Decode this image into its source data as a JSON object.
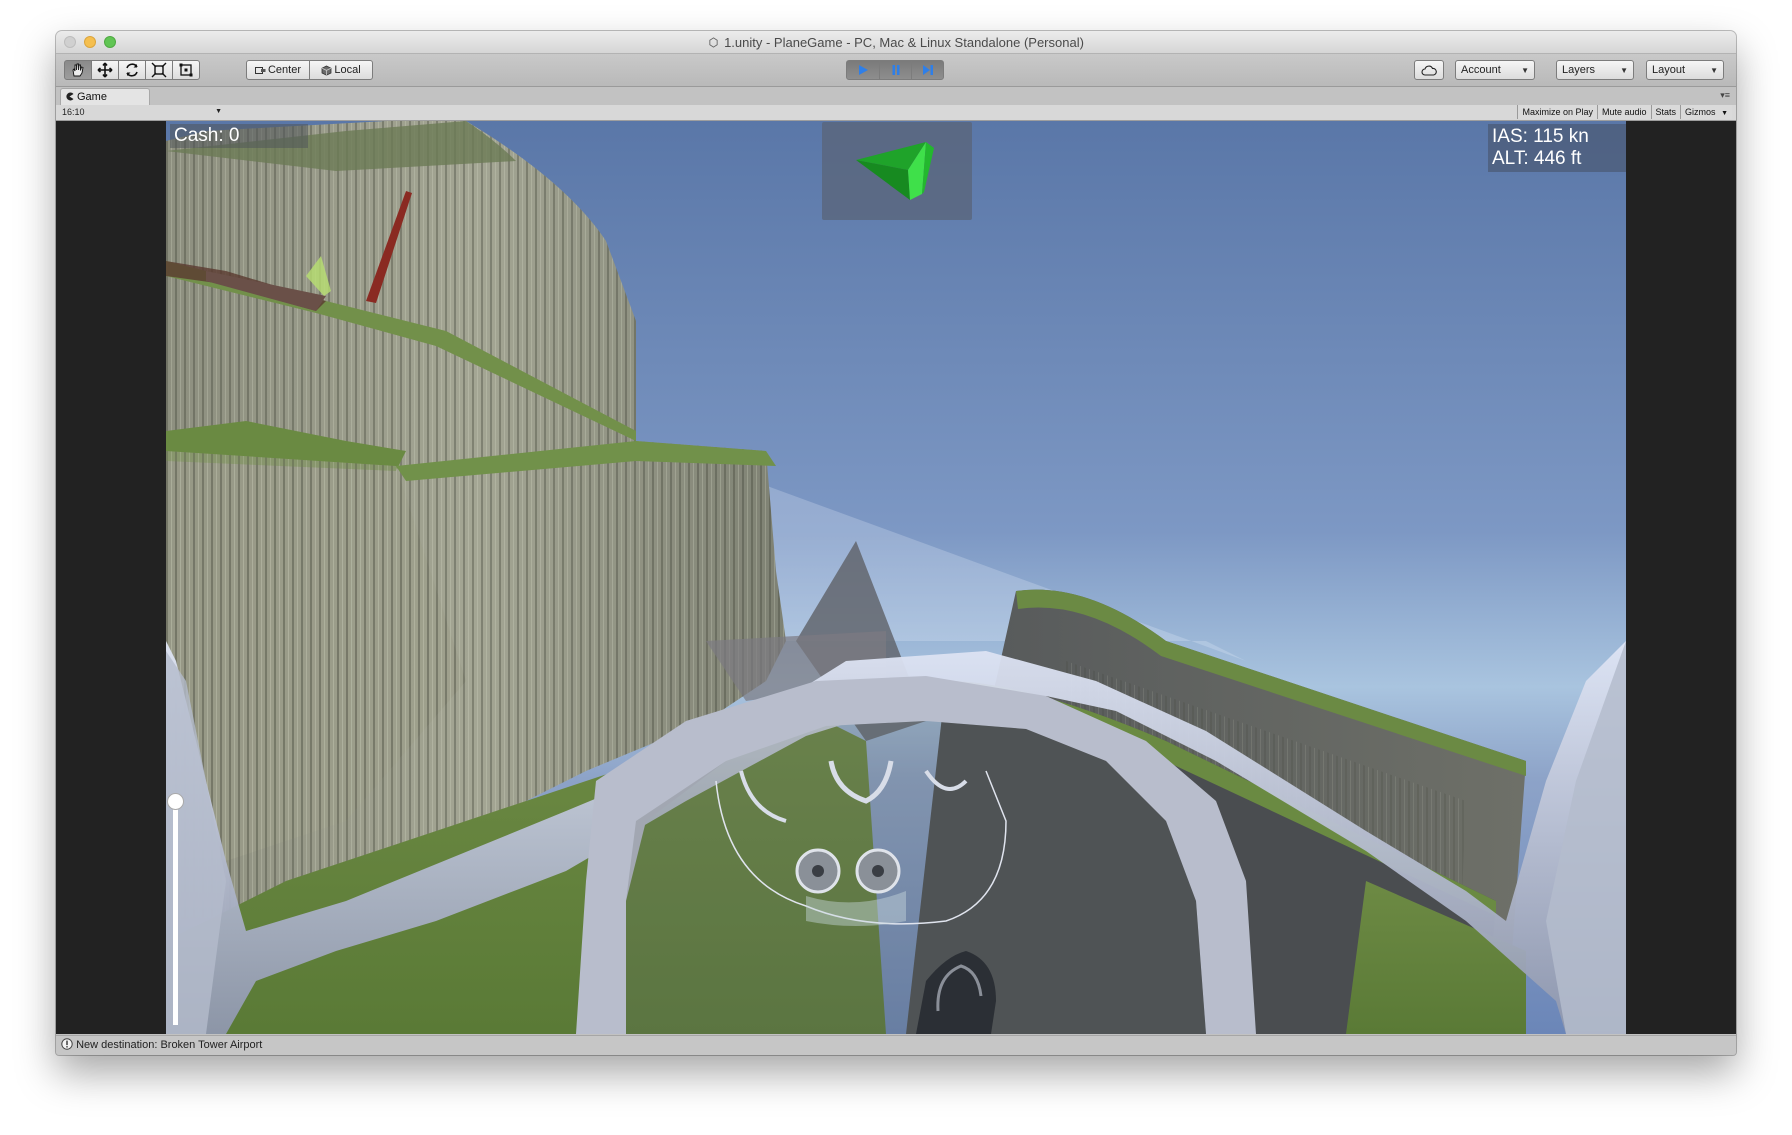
{
  "window": {
    "title": "1.unity - PlaneGame - PC, Mac & Linux Standalone (Personal)"
  },
  "toolbar": {
    "transform_tools": [
      "hand-icon",
      "move-icon",
      "rotate-icon",
      "scale-icon",
      "rect-tool-icon"
    ],
    "pivot_label": "Center",
    "space_label": "Local",
    "playback": [
      "play-icon",
      "pause-icon",
      "step-icon"
    ],
    "account_label": "Account",
    "layers_label": "Layers",
    "layout_label": "Layout"
  },
  "game_tab": {
    "label": "Game",
    "aspect": "16:10",
    "maximize_label": "Maximize on Play",
    "mute_label": "Mute audio",
    "stats_label": "Stats",
    "gizmos_label": "Gizmos"
  },
  "hud": {
    "cash": "Cash: 0",
    "ias": "IAS: 115 kn",
    "alt": "ALT: 446 ft",
    "throttle_level": 0.97
  },
  "status": {
    "message": "New destination: Broken Tower Airport"
  },
  "colors": {
    "play_active": "#2f7fe8",
    "arrow_green": "#1fa32a"
  }
}
